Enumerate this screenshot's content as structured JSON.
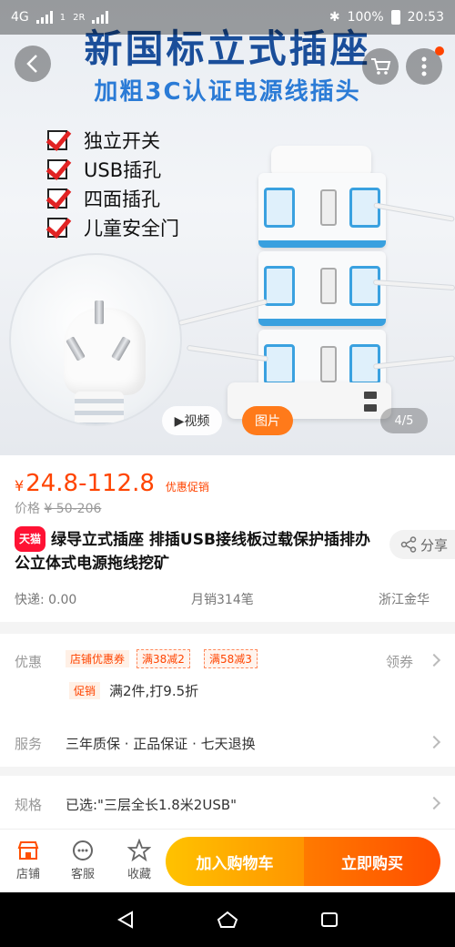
{
  "status_bar": {
    "network": "4G",
    "network2": "2R",
    "sim_badge": "1",
    "battery": "100%",
    "time": "20:53"
  },
  "hero": {
    "title": "新国标立式插座",
    "subtitle": "加粗3C认证电源线插头",
    "features": [
      "独立开关",
      "USB插孔",
      "四面插孔",
      "儿童安全门"
    ],
    "video_label": "▶视频",
    "photo_label": "图片",
    "pager": "4/5"
  },
  "product": {
    "currency": "¥",
    "price": "24.8-112.8",
    "promo_tag": "优惠促销",
    "original_label": "价格",
    "original_price": "¥ 50-206",
    "tmall_badge": "天猫",
    "title": "绿导立式插座 排插USB接线板过载保护插排办公立体式电源拖线挖矿",
    "share": "分享",
    "shipping": "快递: 0.00",
    "monthly_sales": "月销314笔",
    "location": "浙江金华"
  },
  "options": {
    "discount_label": "优惠",
    "coupon_store": "店铺优惠券",
    "coupon_1": "满38减2",
    "coupon_2": "满58减3",
    "claim": "领券",
    "promo_label": "促销",
    "promo_text": "满2件,打9.5折",
    "service_label": "服务",
    "service_text": "三年质保 · 正品保证 · 七天退换",
    "spec_label": "规格",
    "spec_text": "已选:\"三层全长1.8米2USB\""
  },
  "action_bar": {
    "store": "店铺",
    "service": "客服",
    "favorite": "收藏",
    "add_cart": "加入购物车",
    "buy_now": "立即购买"
  },
  "colors": {
    "accent": "#ff4400",
    "cart_gradient_start": "#ffc200",
    "buy_gradient_end": "#ff4e00",
    "tmall": "#ff1234"
  }
}
